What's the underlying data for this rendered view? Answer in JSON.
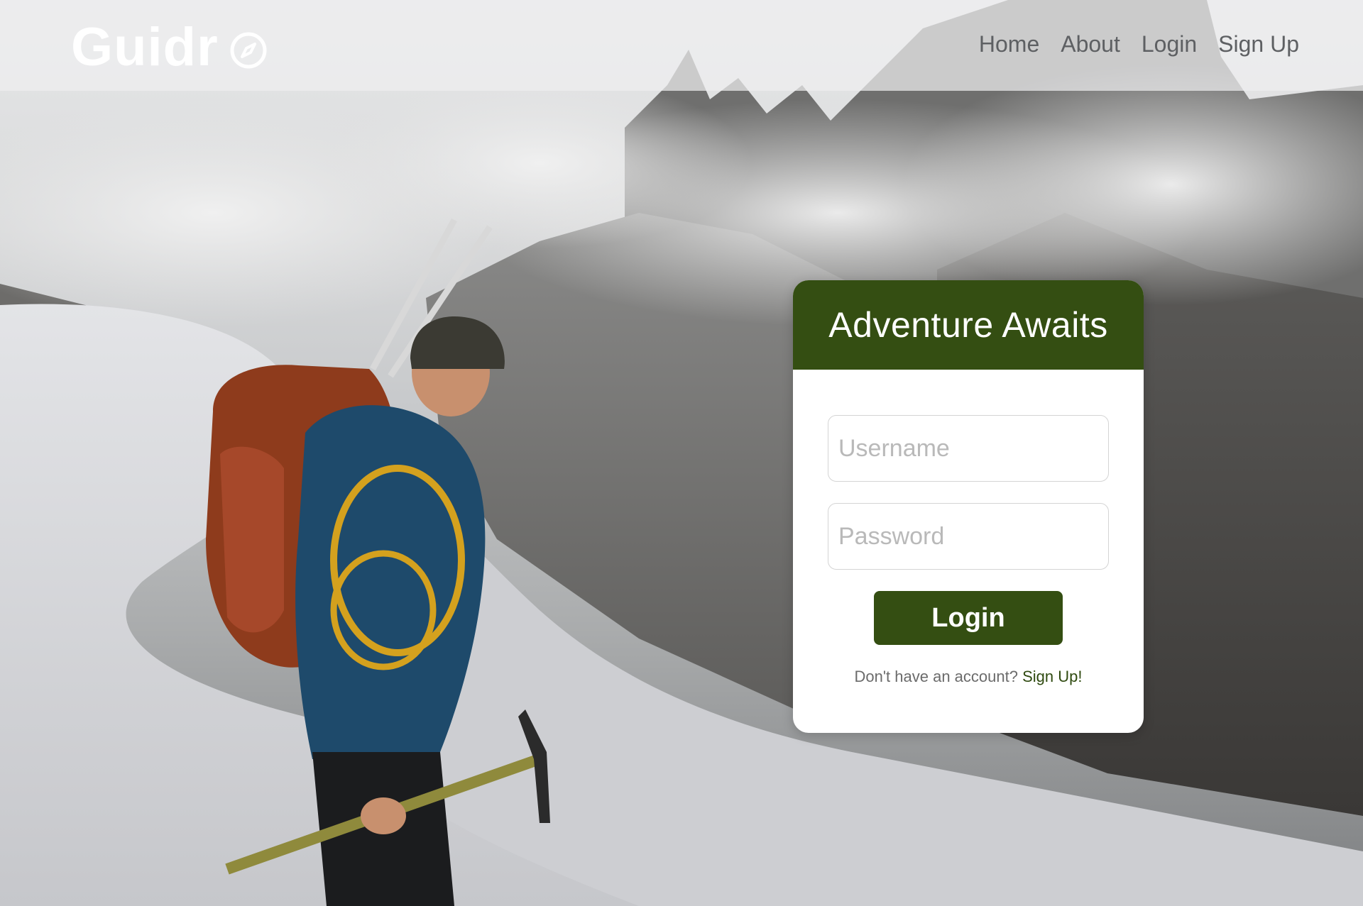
{
  "brand": {
    "name": "Guidr",
    "icon": "compass-icon"
  },
  "nav": {
    "items": [
      {
        "label": "Home"
      },
      {
        "label": "About"
      },
      {
        "label": "Login"
      },
      {
        "label": "Sign Up"
      }
    ]
  },
  "login_card": {
    "title": "Adventure Awaits",
    "username_placeholder": "Username",
    "password_placeholder": "Password",
    "username_value": "",
    "password_value": "",
    "submit_label": "Login",
    "signup_prompt": "Don't have an account?",
    "signup_link": "Sign Up!"
  },
  "colors": {
    "accent": "#344e12",
    "header_bg": "rgba(238,239,240,0.72)",
    "nav_text": "#5e6063",
    "card_bg": "#ffffff"
  }
}
